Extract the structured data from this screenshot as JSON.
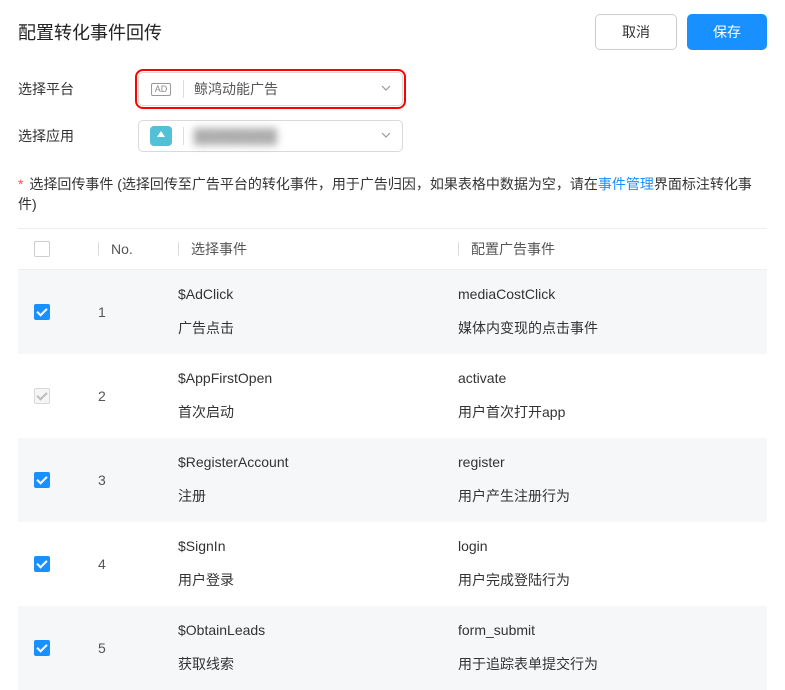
{
  "header": {
    "title": "配置转化事件回传",
    "cancel_label": "取消",
    "save_label": "保存"
  },
  "form": {
    "platform_label": "选择平台",
    "platform_value": "鲸鸿动能广告",
    "platform_icon_text": "AD",
    "app_label": "选择应用",
    "app_value": "████████"
  },
  "hint": {
    "label": "选择回传事件",
    "text_before": " (选择回传至广告平台的转化事件，用于广告归因，如果表格中数据为空，请在",
    "link_text": "事件管理",
    "text_after": "界面标注转化事件)"
  },
  "table": {
    "headers": {
      "no": "No.",
      "event": "选择事件",
      "ad_event": "配置广告事件"
    },
    "rows": [
      {
        "no": "1",
        "checked": true,
        "disabled": false,
        "event_id": "$AdClick",
        "event_name": "广告点击",
        "ad_id": "mediaCostClick",
        "ad_name": "媒体内变现的点击事件"
      },
      {
        "no": "2",
        "checked": true,
        "disabled": true,
        "event_id": "$AppFirstOpen",
        "event_name": "首次启动",
        "ad_id": "activate",
        "ad_name": "用户首次打开app"
      },
      {
        "no": "3",
        "checked": true,
        "disabled": false,
        "event_id": "$RegisterAccount",
        "event_name": "注册",
        "ad_id": "register",
        "ad_name": "用户产生注册行为"
      },
      {
        "no": "4",
        "checked": true,
        "disabled": false,
        "event_id": "$SignIn",
        "event_name": "用户登录",
        "ad_id": "login",
        "ad_name": "用户完成登陆行为"
      },
      {
        "no": "5",
        "checked": true,
        "disabled": false,
        "event_id": "$ObtainLeads",
        "event_name": "获取线索",
        "ad_id": "form_submit",
        "ad_name": "用于追踪表单提交行为"
      }
    ]
  }
}
